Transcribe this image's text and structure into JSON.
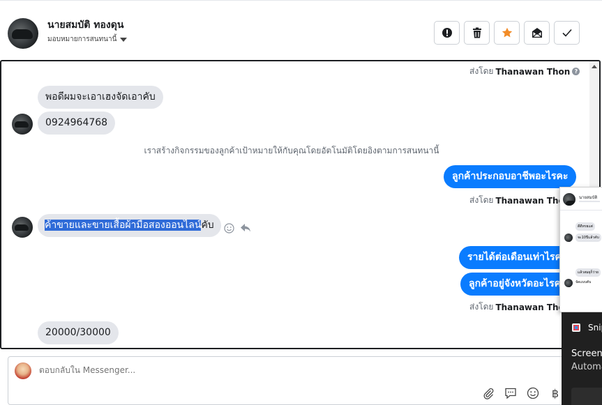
{
  "header": {
    "user_name": "นายสมบัติ ทองดุน",
    "assign_label": "มอบหมายการสนทนานี้",
    "actions": [
      {
        "icon": "alert-icon"
      },
      {
        "icon": "trash-icon"
      },
      {
        "icon": "star-icon"
      },
      {
        "icon": "mark-unread-icon"
      },
      {
        "icon": "check-icon"
      }
    ],
    "star_color": "#f28c28"
  },
  "conversation": {
    "sent_by_prefix": "ส่งโดย",
    "sent_by_name": "Thanawan Thon",
    "messages": {
      "m1": "พอดีผมจะเอาเฮงจัดเอาคับ",
      "m2": "0924964768",
      "system": "เราสร้างกิจกรรมของลูกค้าเป้าหมายให้กับคุณโดยอัตโนมัติโดยอิงตามการสนทนานี้",
      "m3": "ลูกค้าประกอบอาชีพอะไรคะ",
      "m4_selected": "ค้าขายและขายเสื้อผ้ามือสองออนไลน์",
      "m4_rest": "คับ",
      "m5": "รายได้ต่อเดือนเท่าไรคะ",
      "m6": "ลูกค้าอยู่จังหวัดอะไรคะ",
      "m7": "20000/30000"
    },
    "outgoing_color": "#0a7cff",
    "incoming_color": "#e4e6eb"
  },
  "reply": {
    "placeholder": "ตอบกลับใน Messenger..."
  },
  "snip_overlay": {
    "thumb_name": "นายสมบัติ",
    "thumb_msgs": [
      "ดีดีทรยแต่",
      "จะ10ปีแล้วคับ",
      "แล้วสมผุก็ว่าย",
      "จัดแบบคับ"
    ],
    "title": "Snip",
    "line1": "Screens",
    "line2": "Automa"
  }
}
